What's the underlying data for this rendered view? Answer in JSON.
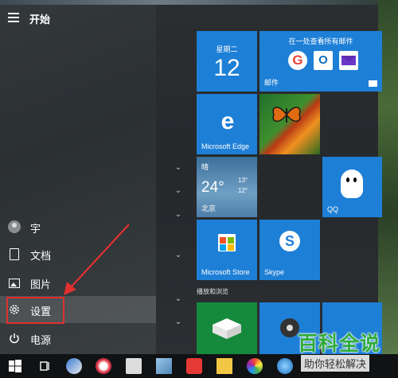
{
  "start_menu": {
    "title": "开始",
    "nav": {
      "user": "宇",
      "documents": "文档",
      "pictures": "图片",
      "settings": "设置",
      "power": "电源"
    }
  },
  "tiles": {
    "calendar": {
      "weekday": "星期二",
      "day": "12"
    },
    "mail": {
      "header": "在一处查看所有邮件",
      "label": "邮件"
    },
    "edge": {
      "label": "Microsoft Edge"
    },
    "weather": {
      "condition": "晴",
      "temp": "24°",
      "high": "13°",
      "low": "12°",
      "city": "北京"
    },
    "qq": {
      "label": "QQ"
    },
    "store": {
      "label": "Microsoft Store"
    },
    "skype": {
      "label": "Skype"
    }
  },
  "groups": {
    "play_and_browse": "播放和浏览"
  },
  "watermark": {
    "title": "百科全说",
    "subtitle": "助你轻松解决"
  },
  "colors": {
    "tile_blue": "#1e7fd6",
    "highlight_red": "#e03030",
    "watermark_green": "#2dab3a"
  }
}
